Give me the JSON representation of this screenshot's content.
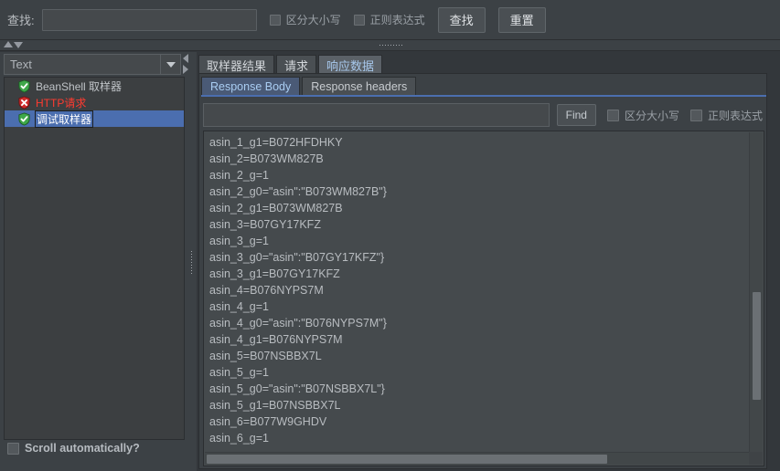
{
  "toolbar": {
    "find_label": "查找:",
    "search_value": "",
    "search_placeholder": "",
    "match_case_label": "区分大小写",
    "regex_label": "正则表达式",
    "find_button": "查找",
    "reset_button": "重置"
  },
  "left_panel": {
    "combo_selected": "Text",
    "combo_options": [
      "Text"
    ],
    "tree_items": [
      {
        "label": "BeanShell 取样器",
        "icon": "shield-success-icon",
        "status": "success",
        "selected": false
      },
      {
        "label": "HTTP请求",
        "icon": "shield-error-icon",
        "status": "error",
        "selected": false
      },
      {
        "label": "调试取样器",
        "icon": "shield-success-icon",
        "status": "success",
        "selected": true
      }
    ],
    "scroll_auto_label": "Scroll automatically?"
  },
  "right_panel": {
    "tabs": [
      {
        "label": "取样器结果",
        "active": false
      },
      {
        "label": "请求",
        "active": false
      },
      {
        "label": "响应数据",
        "active": true
      }
    ],
    "subtabs": [
      {
        "label": "Response Body",
        "active": true
      },
      {
        "label": "Response headers",
        "active": false
      }
    ],
    "find_bar": {
      "value": "",
      "placeholder": "",
      "find_button": "Find",
      "match_case_label": "区分大小写",
      "regex_label": "正则表达式"
    },
    "response_lines": [
      "asin_1_g1=B072HFDHKY",
      "asin_2=B073WM827B",
      "asin_2_g=1",
      "asin_2_g0=\"asin\":\"B073WM827B\"}",
      "asin_2_g1=B073WM827B",
      "asin_3=B07GY17KFZ",
      "asin_3_g=1",
      "asin_3_g0=\"asin\":\"B07GY17KFZ\"}",
      "asin_3_g1=B07GY17KFZ",
      "asin_4=B076NYPS7M",
      "asin_4_g=1",
      "asin_4_g0=\"asin\":\"B076NYPS7M\"}",
      "asin_4_g1=B076NYPS7M",
      "asin_5=B07NSBBX7L",
      "asin_5_g=1",
      "asin_5_g0=\"asin\":\"B07NSBBX7L\"}",
      "asin_5_g1=B07NSBBX7L",
      "asin_6=B077W9GHDV",
      "asin_6_g=1"
    ]
  },
  "colors": {
    "window_bg": "#33373b",
    "panel_bg": "#3c4145",
    "tree_bg": "#3c3f41",
    "text_bg": "#454a4d",
    "selection_blue": "#4b6eaf",
    "active_tab_text": "#a7c8ec",
    "error_red": "#ff3b30",
    "success_green": "#3fa84a",
    "text_primary": "#b8bcc0"
  }
}
